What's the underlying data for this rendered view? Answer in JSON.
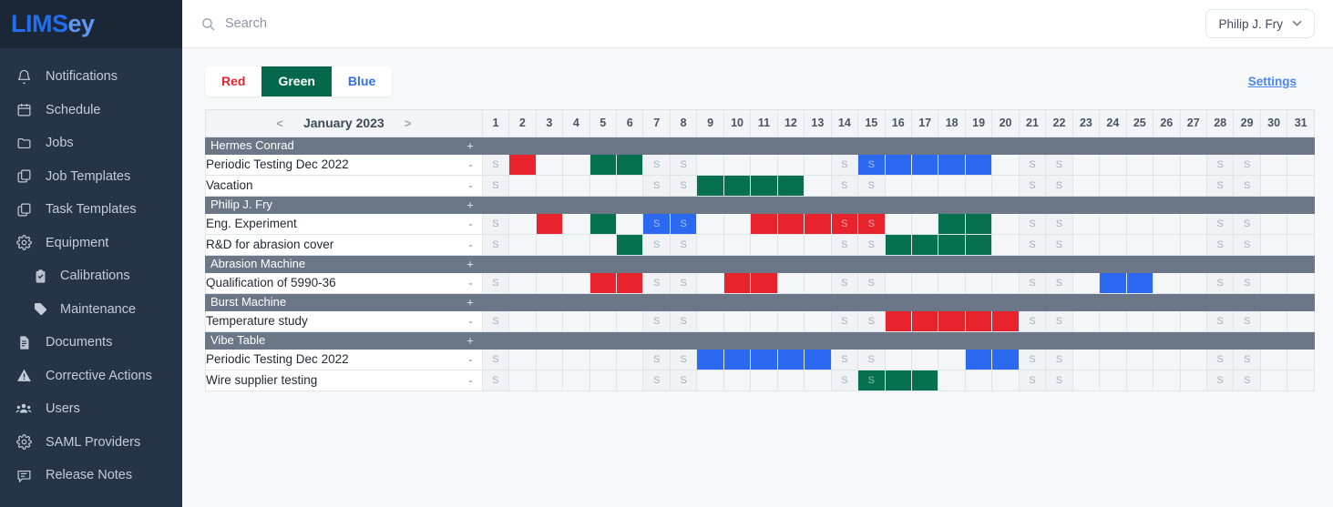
{
  "brand": {
    "part1": "LIMS",
    "part2": "ey"
  },
  "sidebar": {
    "items": [
      {
        "label": "Notifications",
        "icon": "bell-icon",
        "indent": false
      },
      {
        "label": "Schedule",
        "icon": "calendar-icon",
        "indent": false
      },
      {
        "label": "Jobs",
        "icon": "folder-icon",
        "indent": false
      },
      {
        "label": "Job Templates",
        "icon": "copy-icon",
        "indent": false
      },
      {
        "label": "Task Templates",
        "icon": "copy-icon",
        "indent": false
      },
      {
        "label": "Equipment",
        "icon": "gear-icon",
        "indent": false
      },
      {
        "label": "Calibrations",
        "icon": "clipboard-check-icon",
        "indent": true
      },
      {
        "label": "Maintenance",
        "icon": "tag-icon",
        "indent": true
      },
      {
        "label": "Documents",
        "icon": "document-icon",
        "indent": false
      },
      {
        "label": "Corrective Actions",
        "icon": "warning-triangle-icon",
        "indent": false
      },
      {
        "label": "Users",
        "icon": "users-icon",
        "indent": false
      },
      {
        "label": "SAML Providers",
        "icon": "gear-icon",
        "indent": false
      },
      {
        "label": "Release Notes",
        "icon": "speech-bubble-icon",
        "indent": false
      }
    ]
  },
  "topbar": {
    "search_placeholder": "Search",
    "search_value": "",
    "user_name": "Philip J. Fry",
    "caret": "⌄"
  },
  "toolbar": {
    "tabs": [
      {
        "label": "Red",
        "state": "red"
      },
      {
        "label": "Green",
        "state": "active-green"
      },
      {
        "label": "Blue",
        "state": "blue"
      }
    ],
    "settings_label": "Settings"
  },
  "calendar": {
    "prev_arrow": "<",
    "next_arrow": ">",
    "month_label": "January 2023",
    "days": [
      1,
      2,
      3,
      4,
      5,
      6,
      7,
      8,
      9,
      10,
      11,
      12,
      13,
      14,
      15,
      16,
      17,
      18,
      19,
      20,
      21,
      22,
      23,
      24,
      25,
      26,
      27,
      28,
      29,
      30,
      31
    ],
    "weekend_days": [
      1,
      7,
      8,
      14,
      15,
      21,
      22,
      28,
      29
    ],
    "weekend_mark": "S",
    "group_add": "+",
    "task_remove": "-",
    "colors": {
      "red": "#e8232c",
      "green": "#07704f",
      "blue": "#2a69f0",
      "group_header": "#6b7787",
      "weekend_cell": "#f0f2f5"
    },
    "groups": [
      {
        "name": "Hermes Conrad",
        "tasks": [
          {
            "name": "Periodic Testing Dec 2022",
            "bars": [
              {
                "start": 2,
                "end": 2,
                "color": "red"
              },
              {
                "start": 5,
                "end": 6,
                "color": "green"
              },
              {
                "start": 15,
                "end": 19,
                "color": "blue"
              }
            ]
          },
          {
            "name": "Vacation",
            "bars": [
              {
                "start": 9,
                "end": 12,
                "color": "green"
              }
            ]
          }
        ]
      },
      {
        "name": "Philip J. Fry",
        "tasks": [
          {
            "name": "Eng. Experiment",
            "bars": [
              {
                "start": 3,
                "end": 3,
                "color": "red"
              },
              {
                "start": 5,
                "end": 5,
                "color": "green"
              },
              {
                "start": 7,
                "end": 8,
                "color": "blue"
              },
              {
                "start": 11,
                "end": 15,
                "color": "red"
              },
              {
                "start": 18,
                "end": 19,
                "color": "green"
              }
            ]
          },
          {
            "name": "R&D for abrasion cover",
            "bars": [
              {
                "start": 6,
                "end": 6,
                "color": "green"
              },
              {
                "start": 16,
                "end": 19,
                "color": "green"
              }
            ]
          }
        ]
      },
      {
        "name": "Abrasion Machine",
        "tasks": [
          {
            "name": "Qualification of 5990-36",
            "bars": [
              {
                "start": 5,
                "end": 6,
                "color": "red"
              },
              {
                "start": 10,
                "end": 11,
                "color": "red"
              },
              {
                "start": 24,
                "end": 25,
                "color": "blue"
              }
            ]
          }
        ]
      },
      {
        "name": "Burst Machine",
        "tasks": [
          {
            "name": "Temperature study",
            "bars": [
              {
                "start": 16,
                "end": 20,
                "color": "red"
              }
            ]
          }
        ]
      },
      {
        "name": "Vibe Table",
        "tasks": [
          {
            "name": "Periodic Testing Dec 2022",
            "bars": [
              {
                "start": 9,
                "end": 13,
                "color": "blue"
              },
              {
                "start": 19,
                "end": 20,
                "color": "blue"
              }
            ]
          },
          {
            "name": "Wire supplier testing",
            "bars": [
              {
                "start": 15,
                "end": 17,
                "color": "green"
              }
            ]
          }
        ]
      }
    ]
  }
}
